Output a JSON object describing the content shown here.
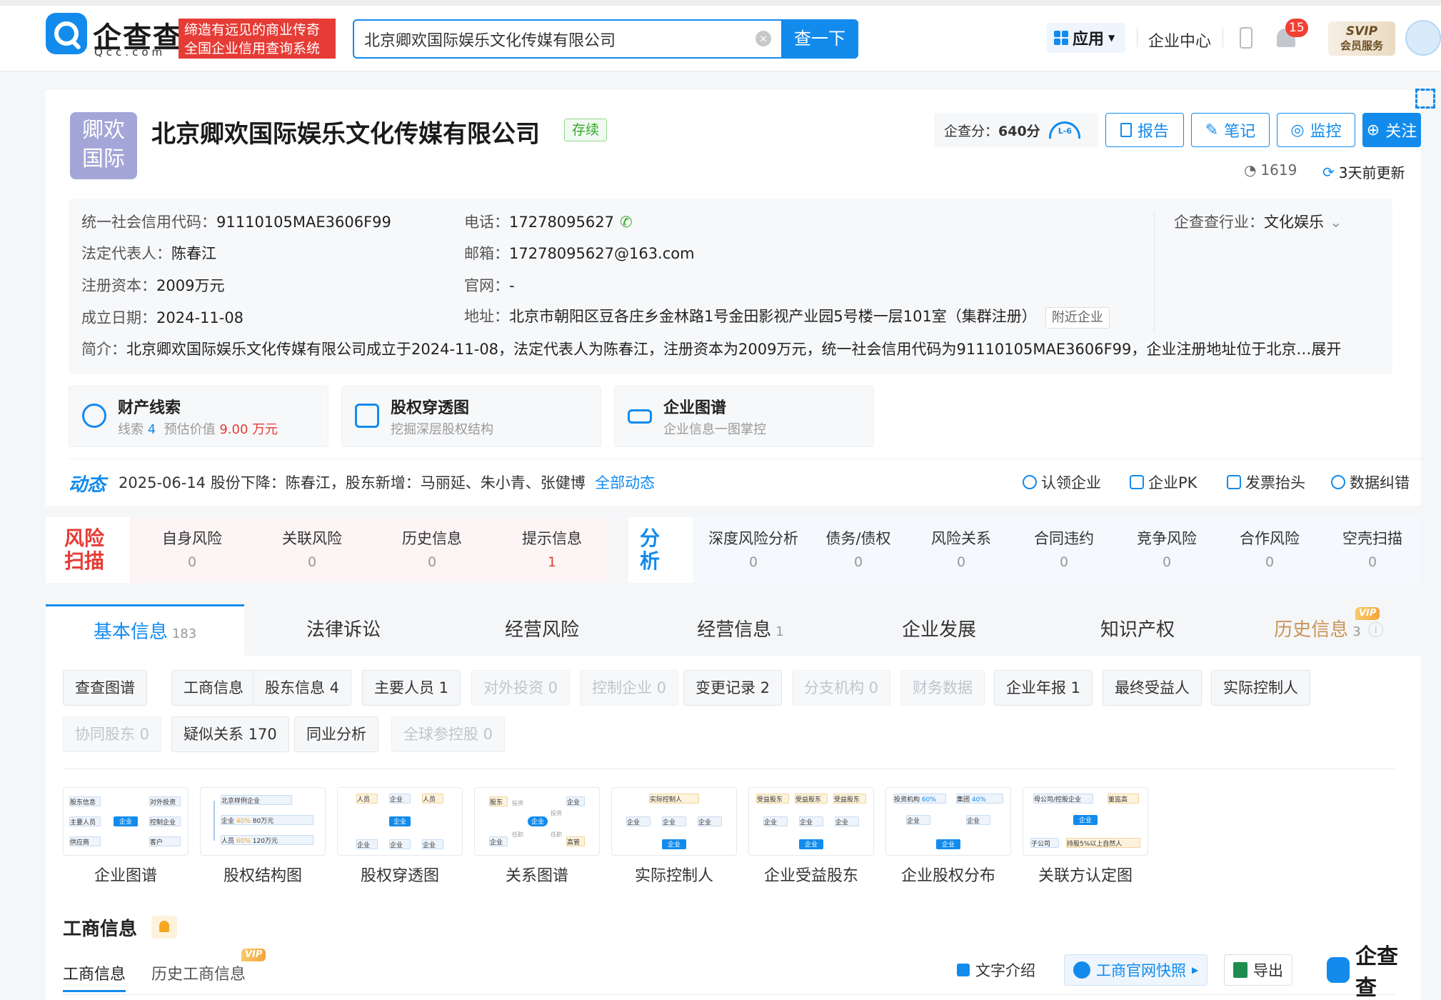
{
  "header": {
    "logo_name": "企查查",
    "logo_sub": "Qcc.com",
    "slogan_line1": "缔造有远见的商业传奇",
    "slogan_line2": "全国企业信用查询系统",
    "search_value": "北京卿欢国际娱乐文化传媒有限公司",
    "search_button": "查一下",
    "nav_app": "应用",
    "nav_center": "企业中心",
    "notif_count": "15",
    "svip_top": "SVIP",
    "svip_bottom": "会员服务"
  },
  "company": {
    "logo_line1": "卿欢",
    "logo_line2": "国际",
    "name": "北京卿欢国际娱乐文化传媒有限公司",
    "status": "存续",
    "score_label": "企查分：",
    "score_value": "640分",
    "score_level": "L-6",
    "actions": [
      "报告",
      "笔记",
      "监控",
      "关注"
    ],
    "views": "1619",
    "updated": "3天前更新"
  },
  "info": {
    "credit_code_label": "统一社会信用代码：",
    "credit_code": "91110105MAE3606F99",
    "legal_label": "法定代表人：",
    "legal": "陈春江",
    "capital_label": "注册资本：",
    "capital": "2009万元",
    "founded_label": "成立日期：",
    "founded": "2024-11-08",
    "phone_label": "电话：",
    "phone": "17278095627",
    "email_label": "邮箱：",
    "email": "17278095627@163.com",
    "website_label": "官网：",
    "website": "-",
    "address_label": "地址：",
    "address": "北京市朝阳区豆各庄乡金林路1号金田影视产业园5号楼一层101室（集群注册）",
    "near_tag": "附近企业",
    "industry_label": "企查查行业：",
    "industry": "文化娱乐",
    "intro_label": "简介：",
    "intro": "北京卿欢国际娱乐文化传媒有限公司成立于2024-11-08，法定代表人为陈春江，注册资本为2009万元，统一社会信用代码为91110105MAE3606F99，企业注册地址位于北京…",
    "expand": "展开"
  },
  "features": [
    {
      "title": "财产线索",
      "sub_a": "线索",
      "sub_a_val": "4",
      "sub_b": "预估价值",
      "sub_b_val": "9.00 万元"
    },
    {
      "title": "股权穿透图",
      "sub": "挖掘深层股权结构"
    },
    {
      "title": "企业图谱",
      "sub": "企业信息一图掌控"
    }
  ],
  "dynamic": {
    "label": "动态",
    "text": "2025-06-14 股份下降：陈春江，股东新增：马丽延、朱小青、张健博",
    "link": "全部动态",
    "tools": [
      "认领企业",
      "企业PK",
      "发票抬头",
      "数据纠错"
    ]
  },
  "risk": {
    "title_line1": "风险",
    "title_line2": "扫描",
    "items": [
      {
        "label": "自身风险",
        "value": "0"
      },
      {
        "label": "关联风险",
        "value": "0"
      },
      {
        "label": "历史信息",
        "value": "0"
      },
      {
        "label": "提示信息",
        "value": "1"
      }
    ]
  },
  "analysis": {
    "title_line1": "分",
    "title_line2": "析",
    "items": [
      {
        "label": "深度风险分析",
        "value": "0"
      },
      {
        "label": "债务/债权",
        "value": "0"
      },
      {
        "label": "风险关系",
        "value": "0"
      },
      {
        "label": "合同违约",
        "value": "0"
      },
      {
        "label": "竞争风险",
        "value": "0"
      },
      {
        "label": "合作风险",
        "value": "0"
      },
      {
        "label": "空壳扫描",
        "value": "0"
      }
    ]
  },
  "tabs": [
    {
      "label": "基本信息",
      "count": "183"
    },
    {
      "label": "法律诉讼",
      "count": ""
    },
    {
      "label": "经营风险",
      "count": ""
    },
    {
      "label": "经营信息",
      "count": "1"
    },
    {
      "label": "企业发展",
      "count": ""
    },
    {
      "label": "知识产权",
      "count": ""
    },
    {
      "label": "历史信息",
      "count": "3"
    }
  ],
  "vip": "VIP",
  "chips_row1": [
    "查查图谱",
    "工商信息",
    "股东信息 4",
    "主要人员 1",
    "对外投资 0",
    "控制企业 0",
    "变更记录 2",
    "分支机构 0",
    "财务数据",
    "企业年报 1",
    "最终受益人",
    "实际控制人"
  ],
  "chips_row2": [
    "协同股东 0",
    "疑似关系 170",
    "同业分析",
    "全球参控股 0"
  ],
  "thumbs": [
    "企业图谱",
    "股权结构图",
    "股权穿透图",
    "关系图谱",
    "实际控制人",
    "企业受益股东",
    "企业股权分布",
    "关联方认定图"
  ],
  "thumb_text": {
    "t1": [
      "股东信息",
      "对外投资",
      "主要人员",
      "企业",
      "控制企业",
      "供应商",
      "客户"
    ],
    "t2": [
      "北京样例企业",
      "企业",
      "40%",
      "80万元",
      "人员",
      "60%",
      "120万元"
    ],
    "t3": [
      "人员",
      "企业",
      "人员",
      "企业",
      "企业",
      "企业",
      "企业"
    ],
    "t4": [
      "股东",
      "投资",
      "企业",
      "企业",
      "投资",
      "企业",
      "任职",
      "任职",
      "高管"
    ],
    "t5": [
      "实际控制人",
      "企业",
      "企业",
      "企业",
      "企业"
    ],
    "t6": [
      "受益股东",
      "受益股东",
      "受益股东",
      "企业",
      "企业",
      "企业",
      "企业"
    ],
    "t7": [
      "投资机构",
      "60%",
      "集团",
      "40%",
      "企业",
      "企业",
      "企业"
    ],
    "t8": [
      "母公司/控股企业",
      "董监高",
      "企业",
      "子公司",
      "持股5%以上自然人"
    ]
  },
  "section": {
    "title": "工商信息",
    "sub_tabs": [
      "工商信息",
      "历史工商信息"
    ],
    "buttons": [
      "文字介绍",
      "工商官网快照",
      "导出"
    ],
    "brand": "企查查"
  }
}
